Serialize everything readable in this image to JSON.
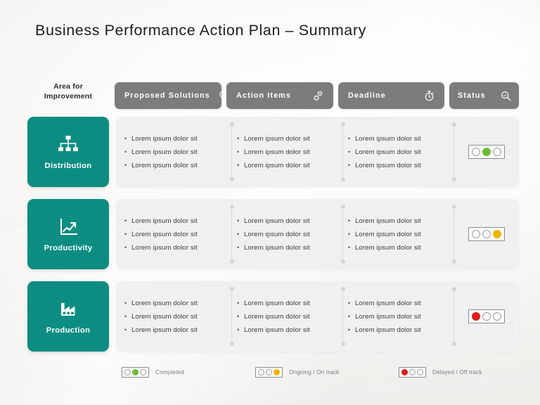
{
  "slide": {
    "title": "Business Performance Action Plan – Summary",
    "accent_teal": "#0d8d82",
    "header_gray": "#7c7c7c",
    "panel_gray": "#f0f0f0"
  },
  "header": {
    "area_label_line1": "Area for",
    "area_label_line2": "Improvement",
    "columns": [
      {
        "label": "Proposed  Solutions",
        "icon": "lightbulb-icon"
      },
      {
        "label": "Action  Items",
        "icon": "gears-icon"
      },
      {
        "label": "Deadline",
        "icon": "stopwatch-icon"
      },
      {
        "label": "Status",
        "icon": "magnifier-icon"
      }
    ]
  },
  "rows": [
    {
      "area": {
        "label": "Distribution",
        "icon": "org-chart-icon"
      },
      "solutions": [
        "Lorem ipsum dolor sit",
        "Lorem ipsum dolor sit",
        "Lorem ipsum dolor sit"
      ],
      "actions": [
        "Lorem ipsum dolor sit",
        "Lorem ipsum dolor sit",
        "Lorem ipsum dolor sit"
      ],
      "deadline": [
        "Lorem ipsum dolor sit",
        "Lorem ipsum dolor sit",
        "Lorem ipsum dolor sit"
      ],
      "status": {
        "state": "completed",
        "lit_index": 1,
        "color": "#6cbd32"
      }
    },
    {
      "area": {
        "label": "Productivity",
        "icon": "line-chart-icon"
      },
      "solutions": [
        "Lorem ipsum dolor sit",
        "Lorem ipsum dolor sit",
        "Lorem ipsum dolor sit"
      ],
      "actions": [
        "Lorem ipsum dolor sit",
        "Lorem ipsum dolor sit",
        "Lorem ipsum dolor sit"
      ],
      "deadline": [
        "Lorem ipsum dolor sit",
        "Lorem ipsum dolor sit",
        "Lorem ipsum dolor sit"
      ],
      "status": {
        "state": "ongoing",
        "lit_index": 2,
        "color": "#f0b400"
      }
    },
    {
      "area": {
        "label": "Production",
        "icon": "factory-icon"
      },
      "solutions": [
        "Lorem ipsum dolor sit",
        "Lorem ipsum dolor sit",
        "Lorem ipsum dolor sit"
      ],
      "actions": [
        "Lorem ipsum dolor sit",
        "Lorem ipsum dolor sit",
        "Lorem ipsum dolor sit"
      ],
      "deadline": [
        "Lorem ipsum dolor sit",
        "Lorem ipsum dolor sit",
        "Lorem ipsum dolor sit"
      ],
      "status": {
        "state": "delayed",
        "lit_index": 0,
        "color": "#e01b1b"
      }
    }
  ],
  "legend": [
    {
      "label": "Completed",
      "lit_index": 1,
      "color": "#6cbd32"
    },
    {
      "label": "Ongoing / On track",
      "lit_index": 2,
      "color": "#f0b400"
    },
    {
      "label": "Delayed / Off track",
      "lit_index": 0,
      "color": "#e01b1b"
    }
  ]
}
